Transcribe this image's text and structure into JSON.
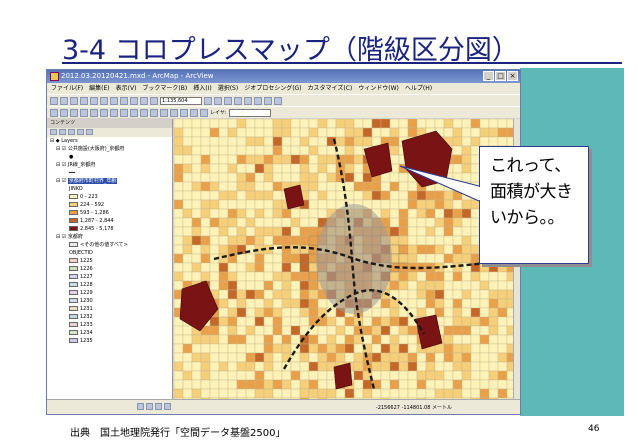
{
  "slide": {
    "title": "3-4 コロプレスマップ（階級区分図）",
    "source": "出典　国土地理院発行「空間データ基盤2500」",
    "page_number": "46"
  },
  "callout": {
    "text": "これって、\n面積が大き\nいから。。"
  },
  "window": {
    "title": "2012.03.20120421.mxd - ArcMap - ArcView",
    "menu": [
      "ファイル(F)",
      "編集(E)",
      "表示(V)",
      "ブックマーク(B)",
      "挿入(I)",
      "選択(S)",
      "ジオプロセシング(G)",
      "カスタマイズ(C)",
      "ウィンドウ(W)",
      "ヘルプ(H)"
    ],
    "scale": "1:135,604",
    "layer_label": "レイヤ:",
    "toc_title": "コンテンツ",
    "status_coords": "-2156627  -114801.08 メートル"
  },
  "toc": {
    "layers_label": "Layers",
    "layer1": "公共施設(大阪府)_京都府",
    "layer2": "JR線_京都府",
    "layer3": "京都府市町村界_年齢",
    "field": "JINKO",
    "legend": [
      {
        "label": "0 - 223",
        "color": "#fdf3b8"
      },
      {
        "label": "224 - 592",
        "color": "#f5cf7a"
      },
      {
        "label": "593 - 1,286",
        "color": "#e8a14a"
      },
      {
        "label": "1,287 - 2,844",
        "color": "#c4682a"
      },
      {
        "label": "2,845 - 5,178",
        "color": "#7a1414"
      }
    ],
    "layer4": "京都府",
    "other_label": "<その他の値すべて>",
    "objectid": "OBJECTID",
    "ids": [
      "1225",
      "1226",
      "1227",
      "1228",
      "1229",
      "1230",
      "1231",
      "1232",
      "1233",
      "1234",
      "1235"
    ],
    "id_colors": [
      "#f2d3c8",
      "#cfe0c0",
      "#d6d0ea",
      "#c8dde6",
      "#e6d2e8",
      "#d0d8f0",
      "#e8e0c0",
      "#c0d8e0",
      "#ead0d0",
      "#d8e6c8",
      "#d0c8e8"
    ]
  },
  "colors": {
    "title": "#1a237e",
    "accent_band": "#5fb8b8",
    "map_low": "#fdf3b8",
    "map_high": "#7a1414"
  }
}
